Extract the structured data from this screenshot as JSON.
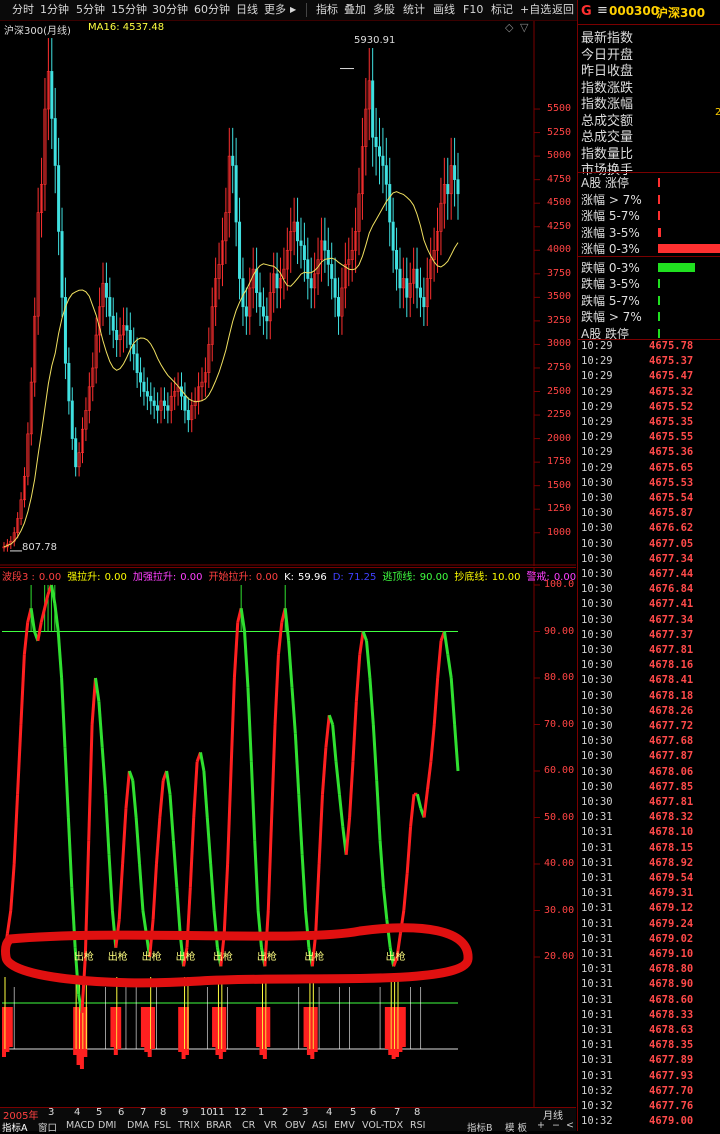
{
  "toolbar": {
    "periods": [
      "分时",
      "1分钟",
      "5分钟",
      "15分钟",
      "30分钟",
      "60分钟",
      "日线",
      "更多"
    ],
    "more_arrow": "▶",
    "tools": [
      "指标",
      "叠加",
      "多股",
      "统计",
      "画线",
      "F10",
      "标记",
      "+自选",
      "返回"
    ]
  },
  "main_chart": {
    "title": "沪深300(月线)",
    "ma_label": "MA16: 4537.48",
    "high_label": "5930.91",
    "low_label": "807.78",
    "y_ticks": [
      "5500",
      "5250",
      "5000",
      "4750",
      "4500",
      "4250",
      "4000",
      "3750",
      "3500",
      "3250",
      "3000",
      "2750",
      "2500",
      "2250",
      "2000",
      "1750",
      "1500",
      "1250",
      "1000"
    ],
    "ylim": [
      700,
      6350
    ],
    "closes": [
      850,
      880,
      910,
      1000,
      1150,
      1350,
      1600,
      2050,
      2600,
      3300,
      4400,
      4700,
      5500,
      5900,
      5400,
      4900,
      4200,
      3500,
      2800,
      2400,
      2000,
      1700,
      1850,
      2100,
      2300,
      2550,
      2750,
      3100,
      3400,
      3650,
      3500,
      3300,
      3150,
      3050,
      3100,
      3200,
      3150,
      3000,
      2900,
      2700,
      2600,
      2500,
      2450,
      2400,
      2350,
      2300,
      2400,
      2350,
      2300,
      2450,
      2500,
      2550,
      2450,
      2300,
      2200,
      2350,
      2400,
      2550,
      2600,
      2700,
      3000,
      3400,
      3700,
      3850,
      4100,
      4400,
      5000,
      4900,
      4300,
      3700,
      3400,
      3300,
      3600,
      3800,
      3550,
      3400,
      3300,
      3250,
      3550,
      3750,
      3600,
      3700,
      3800,
      4000,
      4200,
      4300,
      4100,
      4050,
      3900,
      3700,
      3600,
      3750,
      3900,
      4100,
      4000,
      3850,
      3700,
      3500,
      3300,
      3600,
      3850,
      3900,
      4000,
      4200,
      4600,
      5100,
      5500,
      5800,
      5200,
      5100,
      5000,
      4900,
      4700,
      4300,
      4000,
      3800,
      3600,
      3700,
      3500,
      3650,
      3800,
      3600,
      3500,
      3400,
      3700,
      3900,
      4000,
      4200,
      4500,
      4700,
      4600,
      4900,
      4750,
      4600
    ]
  },
  "indicator": {
    "name": "波段3",
    "params": [
      {
        "label": "波段3 :",
        "value": "0.00",
        "color": "#ff4040"
      },
      {
        "label": "强拉升:",
        "value": "0.00",
        "color": "#ffff00"
      },
      {
        "label": "加强拉升:",
        "value": "0.00",
        "color": "#ff40ff"
      },
      {
        "label": "开始拉升:",
        "value": "0.00",
        "color": "#ff4040"
      },
      {
        "label": "K:",
        "value": "59.96",
        "color": "#ffffff"
      },
      {
        "label": "D:",
        "value": "71.25",
        "color": "#4040ff"
      },
      {
        "label": "逃顶线:",
        "value": "90.00",
        "color": "#40ff40"
      },
      {
        "label": "抄底线:",
        "value": "10.00",
        "color": "#ffff00"
      },
      {
        "label": "警戒:",
        "value": "0.00",
        "color": "#ff40ff"
      }
    ],
    "y_ticks": [
      "100.0",
      "90.00",
      "80.00",
      "70.00",
      "60.00",
      "50.00",
      "40.00",
      "30.00",
      "20.00"
    ],
    "signal_text": "出枪",
    "series": [
      20,
      25,
      30,
      40,
      55,
      70,
      85,
      92,
      95,
      90,
      88,
      92,
      95,
      98,
      100,
      96,
      90,
      80,
      65,
      50,
      35,
      22,
      12,
      8,
      20,
      45,
      70,
      80,
      75,
      65,
      55,
      42,
      30,
      22,
      28,
      40,
      52,
      60,
      58,
      50,
      40,
      30,
      25,
      20,
      28,
      40,
      50,
      58,
      60,
      55,
      45,
      35,
      25,
      18,
      22,
      35,
      50,
      62,
      64,
      60,
      50,
      40,
      30,
      22,
      18,
      25,
      40,
      60,
      80,
      92,
      95,
      90,
      78,
      62,
      45,
      30,
      22,
      18,
      30,
      50,
      70,
      85,
      92,
      95,
      88,
      78,
      68,
      55,
      42,
      30,
      22,
      18,
      25,
      40,
      55,
      65,
      72,
      70,
      62,
      55,
      48,
      42,
      50,
      62,
      75,
      85,
      90,
      88,
      80,
      70,
      58,
      45,
      35,
      28,
      22,
      18,
      20,
      25,
      30,
      38,
      48,
      55,
      55,
      52,
      50,
      56,
      62,
      70,
      80,
      88,
      90,
      85,
      80,
      70,
      60
    ]
  },
  "bottom": {
    "year_label": "2005年",
    "months": [
      "3",
      "4",
      "5",
      "6",
      "7",
      "8",
      "9",
      "10",
      "11",
      "12",
      "1",
      "2",
      "3",
      "4",
      "5",
      "6",
      "7",
      "8"
    ],
    "period_label": "月线",
    "tabs": [
      "指标A",
      "窗口",
      "MACD",
      "DMI",
      "DMA",
      "FSL",
      "TRIX",
      "BRAR",
      "CR",
      "VR",
      "OBV",
      "ASI",
      "EMV",
      "VOL-TDX",
      "RSI"
    ],
    "right_tabs": [
      "指标B",
      "模 板",
      "+",
      "−",
      "<"
    ]
  },
  "right_panel": {
    "logo": "G",
    "menu_icon": "≡",
    "code": "000300",
    "name": "沪深300",
    "fields": [
      "最新指数",
      "今日开盘",
      "昨日收盘",
      "指数涨跌",
      "指数涨幅",
      "总成交额",
      "总成交量",
      "指数量比",
      "市场换手"
    ],
    "field_partial_value": "2",
    "breadth": [
      {
        "label": "A股 涨停",
        "bar": 0.01,
        "color": "#ff3030"
      },
      {
        "label": "涨幅 > 7%",
        "bar": 0.01,
        "color": "#ff3030"
      },
      {
        "label": "涨幅 5-7%",
        "bar": 0.01,
        "color": "#ff3030"
      },
      {
        "label": "涨幅 3-5%",
        "bar": 0.05,
        "color": "#ff3030"
      },
      {
        "label": "涨幅 0-3%",
        "bar": 1.0,
        "color": "#ff3030"
      },
      {
        "label": "跌幅 0-3%",
        "bar": 0.6,
        "color": "#20e020"
      },
      {
        "label": "跌幅 3-5%",
        "bar": 0.01,
        "color": "#20e020"
      },
      {
        "label": "跌幅 5-7%",
        "bar": 0.01,
        "color": "#20e020"
      },
      {
        "label": "跌幅 > 7%",
        "bar": 0.01,
        "color": "#20e020"
      },
      {
        "label": "A股 跌停",
        "bar": 0.01,
        "color": "#20e020"
      }
    ],
    "ticks": [
      [
        "10:29",
        "4675.78"
      ],
      [
        "10:29",
        "4675.37"
      ],
      [
        "10:29",
        "4675.47"
      ],
      [
        "10:29",
        "4675.32"
      ],
      [
        "10:29",
        "4675.52"
      ],
      [
        "10:29",
        "4675.35"
      ],
      [
        "10:29",
        "4675.55"
      ],
      [
        "10:29",
        "4675.36"
      ],
      [
        "10:29",
        "4675.65"
      ],
      [
        "10:30",
        "4675.53"
      ],
      [
        "10:30",
        "4675.54"
      ],
      [
        "10:30",
        "4675.87"
      ],
      [
        "10:30",
        "4676.62"
      ],
      [
        "10:30",
        "4677.05"
      ],
      [
        "10:30",
        "4677.34"
      ],
      [
        "10:30",
        "4677.44"
      ],
      [
        "10:30",
        "4676.84"
      ],
      [
        "10:30",
        "4677.41"
      ],
      [
        "10:30",
        "4677.34"
      ],
      [
        "10:30",
        "4677.37"
      ],
      [
        "10:30",
        "4677.81"
      ],
      [
        "10:30",
        "4678.16"
      ],
      [
        "10:30",
        "4678.41"
      ],
      [
        "10:30",
        "4678.18"
      ],
      [
        "10:30",
        "4678.26"
      ],
      [
        "10:30",
        "4677.72"
      ],
      [
        "10:30",
        "4677.68"
      ],
      [
        "10:30",
        "4677.87"
      ],
      [
        "10:30",
        "4678.06"
      ],
      [
        "10:30",
        "4677.85"
      ],
      [
        "10:30",
        "4677.81"
      ],
      [
        "10:31",
        "4678.32"
      ],
      [
        "10:31",
        "4678.10"
      ],
      [
        "10:31",
        "4678.15"
      ],
      [
        "10:31",
        "4678.92"
      ],
      [
        "10:31",
        "4679.54"
      ],
      [
        "10:31",
        "4679.31"
      ],
      [
        "10:31",
        "4679.12"
      ],
      [
        "10:31",
        "4679.24"
      ],
      [
        "10:31",
        "4679.02"
      ],
      [
        "10:31",
        "4679.10"
      ],
      [
        "10:31",
        "4678.80"
      ],
      [
        "10:31",
        "4678.90"
      ],
      [
        "10:31",
        "4678.60"
      ],
      [
        "10:31",
        "4678.33"
      ],
      [
        "10:31",
        "4678.63"
      ],
      [
        "10:31",
        "4678.35"
      ],
      [
        "10:31",
        "4677.89"
      ],
      [
        "10:31",
        "4677.93"
      ],
      [
        "10:32",
        "4677.70"
      ],
      [
        "10:32",
        "4677.76"
      ],
      [
        "10:32",
        "4679.00"
      ]
    ]
  }
}
